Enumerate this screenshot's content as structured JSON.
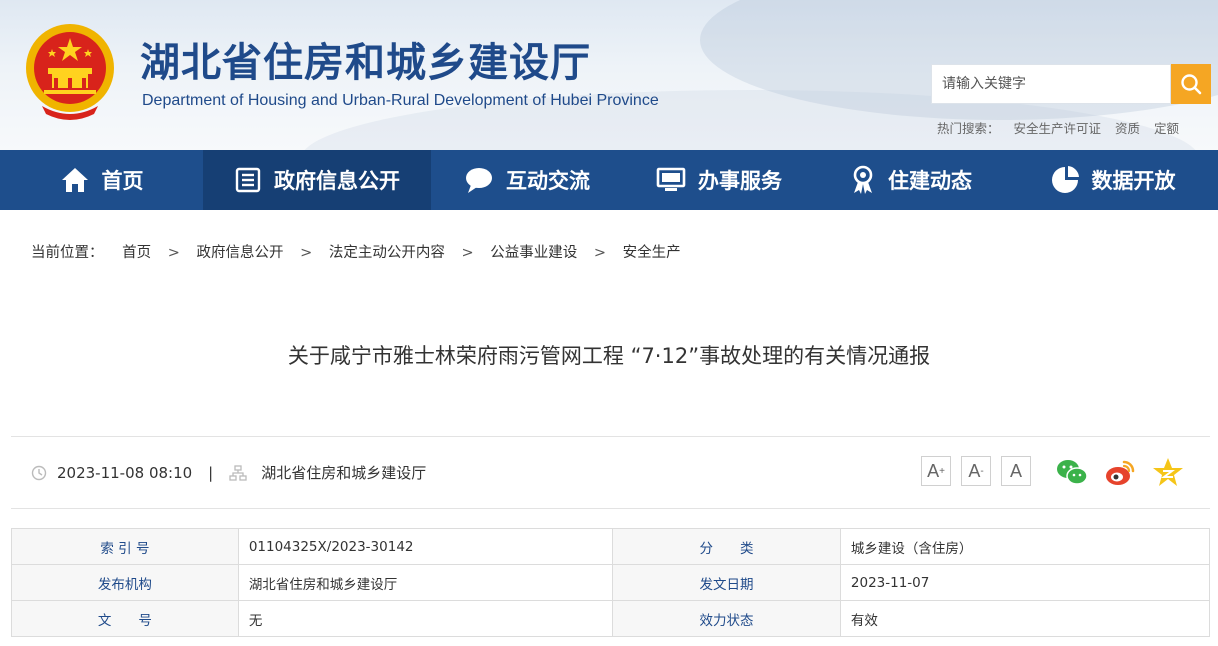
{
  "header": {
    "title_cn": "湖北省住房和城乡建设厅",
    "title_en": "Department of Housing and Urban-Rural Development of Hubei Province",
    "search_placeholder": "请输入关键字",
    "hot_label": "热门搜索：",
    "hot_keywords": [
      "安全生产许可证",
      "资质",
      "定额"
    ]
  },
  "nav": {
    "items": [
      {
        "label": "首页",
        "icon": "home-icon"
      },
      {
        "label": "政府信息公开",
        "icon": "document-list-icon"
      },
      {
        "label": "互动交流",
        "icon": "chat-bubble-icon"
      },
      {
        "label": "办事服务",
        "icon": "monitor-icon"
      },
      {
        "label": "住建动态",
        "icon": "award-icon"
      },
      {
        "label": "数据开放",
        "icon": "pie-chart-icon"
      }
    ],
    "active_index": 1
  },
  "breadcrumb": {
    "label": "当前位置：",
    "items": [
      "首页",
      "政府信息公开",
      "法定主动公开内容",
      "公益事业建设",
      "安全生产"
    ],
    "separator": ">"
  },
  "article": {
    "title": "关于咸宁市雅士林荣府雨污管网工程 “7·12”事故处理的有关情况通报",
    "date": "2023-11-08 08:10",
    "divider": "|",
    "source": "湖北省住房和城乡建设厅",
    "font_controls": [
      "A",
      "A",
      "A"
    ],
    "font_control_marks": [
      "+",
      "-",
      ""
    ]
  },
  "info_table": {
    "rows": [
      {
        "k1": "索 引 号",
        "v1": "01104325X/2023-30142",
        "k2": "分　　类",
        "v2": "城乡建设（含住房）"
      },
      {
        "k1": "发布机构",
        "v1": "湖北省住房和城乡建设厅",
        "k2": "发文日期",
        "v2": "2023-11-07"
      },
      {
        "k1": "文　　号",
        "v1": "无",
        "k2": "效力状态",
        "v2": "有效"
      }
    ]
  },
  "colors": {
    "nav_bg": "#1e4e8c",
    "nav_active": "#163f74",
    "title_blue": "#1f4a8a",
    "search_btn": "#f5a623"
  }
}
